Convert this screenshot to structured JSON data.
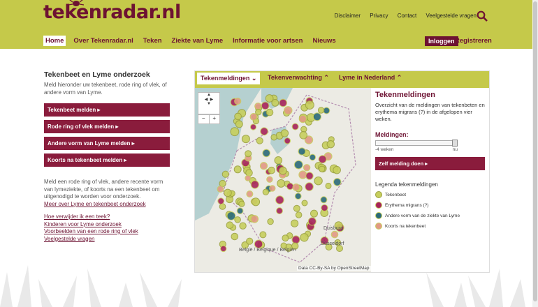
{
  "header": {
    "logo_text": "tekenradar.nl",
    "top_links": [
      "Disclaimer",
      "Privacy",
      "Contact",
      "Veelgestelde vragen"
    ],
    "nav": [
      "Home",
      "Over Tekenradar.nl",
      "Teken",
      "Ziekte van Lyme",
      "Informatie voor artsen",
      "Nieuws"
    ],
    "login_label": "Inloggen",
    "register_label": "Registreren"
  },
  "left": {
    "title": "Tekenbeet en Lyme onderzoek",
    "intro": "Meld hieronder uw tekenbeet, rode ring of vlek, of andere vorm van Lyme.",
    "buttons": [
      "Tekenbeet melden ▸",
      "Rode ring of vlek melden ▸",
      "Andere vorm van Lyme melden ▸",
      "Koorts na tekenbeet melden ▸"
    ],
    "body": "Meld een rode ring of vlek, andere recente vorm van lymeziekte, of koorts na een tekenbeet om uitgenodigd te worden voor onderzoek.",
    "more_link": "Meer over Lyme en tekenbeet onderzoek",
    "links": [
      "Hoe verwijder ik een teek?",
      "Kinderen voor Lyme onderzoek",
      "Voorbeelden van een rode ring of vlek",
      "Veelgestelde vragen"
    ]
  },
  "map_panel": {
    "tabs": [
      "Tekenmeldingen",
      "Tekenverwachting",
      "Lyme in Nederland"
    ],
    "title": "Tekenmeldingen",
    "desc": "Overzicht van de meldingen van tekenbeten en erythema migrans (?) in de afgelopen vier weken.",
    "slider_label": "Meldingen:",
    "slider_value": 1.0,
    "slider_min": "-4 weken",
    "slider_max": "nu",
    "zelf_button": "Zelf melding doen ▸",
    "legend_title": "Legenda tekenmeldingen",
    "legend": [
      {
        "label": "Tekenbeet",
        "color": "#c7cf5d"
      },
      {
        "label": "Erythema migrans (?)",
        "color": "#a7245a"
      },
      {
        "label": "Andere vorm van de ziekte van Lyme",
        "color": "#2b6a78"
      },
      {
        "label": "Koorts na tekenbeet",
        "color": "#e19a84"
      }
    ],
    "map_labels": [
      "Duisburg",
      "Düsseldorf",
      "België / Belgique / Belgien"
    ],
    "attribution": "Data CC-By-SA by OpenStreetMap",
    "zoom_in": "+",
    "zoom_out": "−"
  }
}
